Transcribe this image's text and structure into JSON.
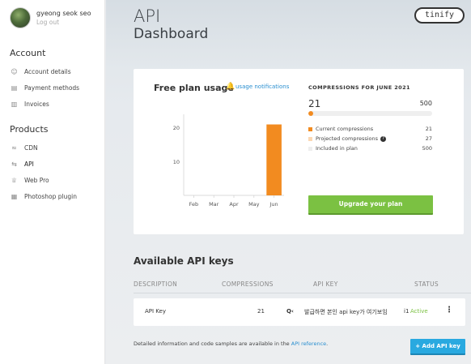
{
  "user": {
    "name": "gyeong seok seo",
    "logout": "Log out"
  },
  "sidebar": {
    "account_title": "Account",
    "account_items": [
      {
        "label": "Account details",
        "icon": "user-icon"
      },
      {
        "label": "Payment methods",
        "icon": "credit-card-icon"
      },
      {
        "label": "Invoices",
        "icon": "document-icon"
      }
    ],
    "products_title": "Products",
    "product_items": [
      {
        "label": "CDN",
        "icon": "cdn-icon"
      },
      {
        "label": "API",
        "icon": "api-icon",
        "active": true
      },
      {
        "label": "Web Pro",
        "icon": "crown-icon"
      },
      {
        "label": "Photoshop plugin",
        "icon": "plugin-icon"
      }
    ]
  },
  "header": {
    "title": "API",
    "subtitle": "Dashboard",
    "logo": "tinify"
  },
  "usage": {
    "title": "Free plan usage",
    "notifications_link": "usage notifications"
  },
  "chart_data": {
    "type": "bar",
    "categories": [
      "Feb",
      "Mar",
      "Apr",
      "May",
      "Jun"
    ],
    "values": [
      0,
      0,
      0,
      0,
      21
    ],
    "yticks": [
      10,
      20
    ],
    "ylim": [
      0,
      24
    ],
    "color": "#f28b20",
    "title": "",
    "xlabel": "",
    "ylabel": ""
  },
  "compressions": {
    "title": "COMPRESSIONS FOR JUNE 2021",
    "current": "21",
    "max": "500",
    "progress_fraction": 0.042,
    "legend": [
      {
        "label": "Current compressions",
        "value": "21",
        "color": "#f28b20"
      },
      {
        "label": "Projected compressions",
        "value": "27",
        "color": "#fbd8b3",
        "help": "?"
      },
      {
        "label": "Included in plan",
        "value": "500",
        "color": "#eeeeee"
      }
    ],
    "upgrade_label": "Upgrade your plan"
  },
  "keys": {
    "title": "Available API keys",
    "headers": {
      "description": "DESCRIPTION",
      "compressions": "COMPRESSIONS",
      "api_key": "API KEY",
      "status": "STATUS"
    },
    "row": {
      "description": "API Key",
      "compressions": "21",
      "key_prefix": "Q‹",
      "key": "발급하면 본인 api key가 여기보임",
      "status_prefix": "i1",
      "status": "Active",
      "menu": "⋮"
    }
  },
  "footer": {
    "info_text": "Detailed information and code samples are available in the ",
    "info_link": "API reference",
    "info_end": ".",
    "add_label": "+ Add API key"
  }
}
